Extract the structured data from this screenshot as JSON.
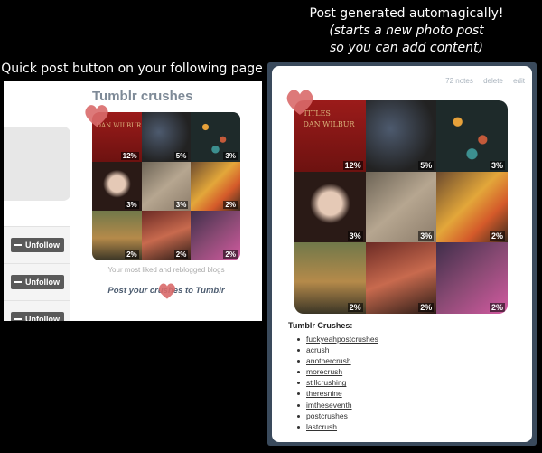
{
  "captions": {
    "left": "Quick post button on your following page",
    "right_line1": "Post generated automagically!",
    "right_line2": "(starts a new photo post",
    "right_line3": "so you can add content)"
  },
  "left_panel": {
    "title": "Tumblr crushes",
    "unfollow_label": "Unfollow",
    "caption": "Your most liked and reblogged blogs",
    "post_link": "Post your crushes to Tumblr",
    "book_text": "DAN WILBUR"
  },
  "tiles": [
    "12%",
    "5%",
    "3%",
    "3%",
    "3%",
    "2%",
    "2%",
    "2%",
    "2%"
  ],
  "post": {
    "notes": "72 notes",
    "delete": "delete",
    "edit": "edit",
    "book_line1": "TITLES",
    "book_line2": "DAN WILBUR",
    "crushes_heading": "Tumblr Crushes:",
    "crushes": [
      "fuckyeahpostcrushes",
      "acrush",
      "anothercrush",
      "morecrush",
      "stillcrushing",
      "theresnine",
      "imtheseventh",
      "postcrushes",
      "lastcrush"
    ]
  },
  "colors": {
    "heart": "#d96a6a",
    "post_frame": "#3a4a5c",
    "background": "#000000"
  }
}
